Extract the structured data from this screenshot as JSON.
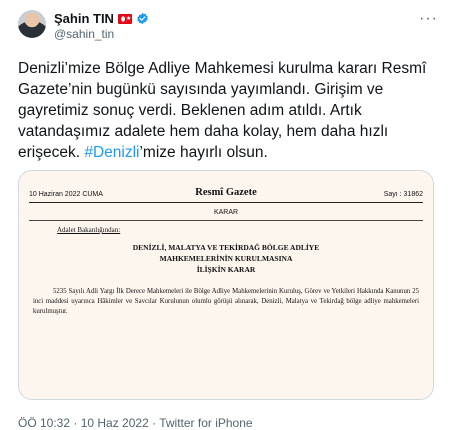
{
  "author": {
    "display_name": "Şahin TIN",
    "handle": "@sahin_tin",
    "flag_icon": "turkey-flag-icon",
    "verified_icon": "verified-badge-icon",
    "more_icon": "more-options-icon",
    "avatar": "profile-avatar"
  },
  "tweet": {
    "text_before": "Denizli’mize Bölge Adliye Mahkemesi kurulma kararı Resmî Gazete’nin bugünkü sayısında yayımlandı. Girişim ve gayretimiz sonuç verdi. Beklenen adım atıldı. Artık vatandaşımız adalete hem daha kolay, hem daha hızlı erişecek. ",
    "hashtag": "#Denizli",
    "text_after": "’mize hayırlı olsun."
  },
  "gazette": {
    "date": "10 Haziran 2022 CUMA",
    "title": "Resmî Gazete",
    "issue": "Sayı : 31862",
    "section": "KARAR",
    "ministry": "Adalet Bakanlığından:",
    "heading_lines": [
      "DENİZLİ, MALATYA VE TEKİRDAĞ BÖLGE ADLİYE",
      "MAHKEMELERİNİN KURULMASINA",
      "İLİŞKİN KARAR"
    ],
    "body": "5235 Sayılı Adli Yargı İlk Derece Mahkemeleri ile Bölge Adliye Mahkemelerinin Kuruluş, Görev ve Yetkileri Hakkında Kanunun 25 inci maddesi uyarınca Hâkimler ve Savcılar Kurulunun olumlu görüşü alınarak, Denizli, Malatya ve Tekirdağ bölge adliye mahkemeleri kurulmuştur."
  },
  "meta": {
    "timestamp": "ÖÖ 10:32 · 10 Haz 2022 · Twitter for iPhone"
  },
  "colors": {
    "text": "#0f1419",
    "secondary": "#536471",
    "link": "#1d9bf0",
    "flag_red": "#e30a17"
  }
}
